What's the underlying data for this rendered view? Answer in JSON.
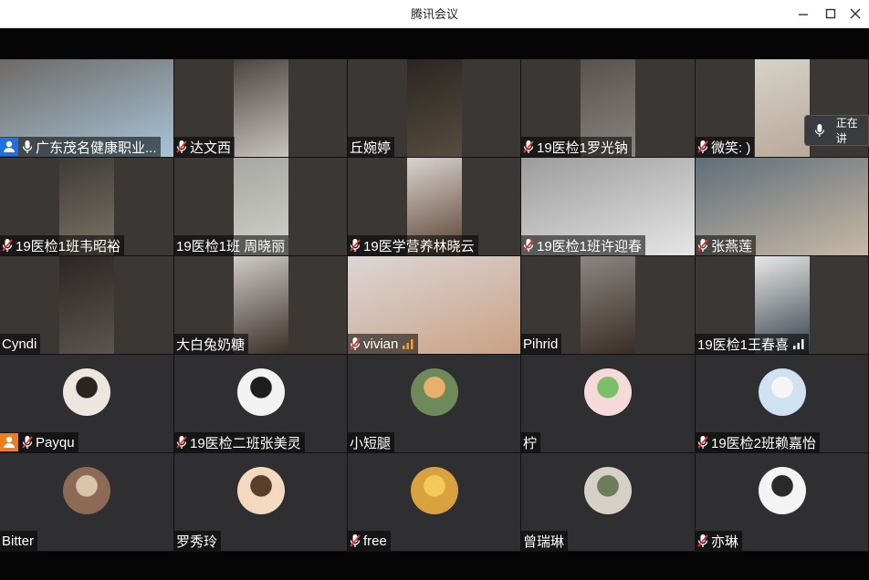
{
  "window": {
    "title": "腾讯会议"
  },
  "speaking_indicator": {
    "label": "正在讲"
  },
  "participants": [
    {
      "name": "广东茂名健康职业...",
      "badge": "host",
      "mic": "on",
      "type": "video",
      "feed": "full"
    },
    {
      "name": "达文西",
      "mic": "muted",
      "type": "video"
    },
    {
      "name": "丘婉婷",
      "type": "video"
    },
    {
      "name": "19医检1罗光钠",
      "mic": "muted",
      "type": "video"
    },
    {
      "name": "微笑: )",
      "mic": "muted",
      "type": "video"
    },
    {
      "name": "19医检1班韦昭裕",
      "mic": "muted",
      "type": "video"
    },
    {
      "name": "19医检1班 周晓丽",
      "type": "video"
    },
    {
      "name": "19医学营养林晓云",
      "mic": "muted",
      "type": "video"
    },
    {
      "name": "19医检1班许迎春",
      "mic": "muted",
      "type": "video",
      "feed": "full"
    },
    {
      "name": "张燕莲",
      "mic": "muted",
      "type": "video",
      "feed": "full"
    },
    {
      "name": "Cyndi",
      "type": "video"
    },
    {
      "name": "大白兔奶糖",
      "type": "video"
    },
    {
      "name": "vivian",
      "mic": "muted",
      "signal": "orange",
      "type": "video",
      "feed": "full"
    },
    {
      "name": "Pihrid",
      "type": "video"
    },
    {
      "name": "19医检1王春喜",
      "signal": "white",
      "type": "video"
    },
    {
      "name": "Payqu",
      "badge": "cohost",
      "mic": "muted",
      "type": "avatar"
    },
    {
      "name": "19医检二班张美灵",
      "mic": "muted",
      "type": "avatar"
    },
    {
      "name": "小短腿",
      "type": "avatar"
    },
    {
      "name": "柠",
      "type": "avatar"
    },
    {
      "name": "19医检2班赖嘉怡",
      "mic": "muted",
      "type": "avatar"
    },
    {
      "name": "Bitter",
      "type": "avatar"
    },
    {
      "name": "罗秀玲",
      "type": "avatar"
    },
    {
      "name": "free",
      "mic": "muted",
      "type": "avatar"
    },
    {
      "name": "曾瑞琳",
      "type": "avatar"
    },
    {
      "name": "亦琳",
      "mic": "muted",
      "type": "avatar"
    }
  ],
  "colors": {
    "tile_bg": "#2f2f31",
    "host_badge": "#1f6fe5",
    "cohost_badge": "#f07c1a",
    "muted_mic": "#e23b3b",
    "signal_orange": "#f0a030"
  },
  "icons": {
    "minimize": "minimize-icon",
    "maximize": "maximize-icon",
    "close": "close-icon",
    "mic": "microphone-icon",
    "mic_muted": "microphone-muted-icon",
    "host": "user-host-icon",
    "signal": "signal-bars-icon"
  }
}
